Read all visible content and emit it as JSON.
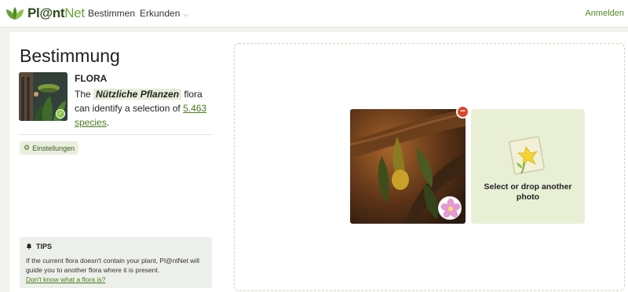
{
  "header": {
    "logo_text_a": "Pl@nt",
    "logo_text_b": "Net",
    "nav": [
      {
        "label": "Bestimmen"
      },
      {
        "label": "Erkunden"
      }
    ],
    "login": "Anmelden"
  },
  "identify": {
    "title": "Bestimmung",
    "flora_label": "FLORA",
    "flora_pre": "The ",
    "flora_name": "Nützliche Pflanzen",
    "flora_mid": " flora can identify a selection of ",
    "species_link": "5.463 species",
    "flora_end": ".",
    "settings_label": "Einstellungen"
  },
  "tips": {
    "title": "TIPS",
    "text": "If the current flora doesn't contain your plant, Pl@ntNet will guide you to another flora where it is present.",
    "link": "Don't know what a flora is?"
  },
  "upload": {
    "add_label": "Select or drop another photo"
  },
  "colors": {
    "accent": "#4e8b1f",
    "remove": "#d9482b",
    "add_card_bg": "#e8efd5"
  }
}
